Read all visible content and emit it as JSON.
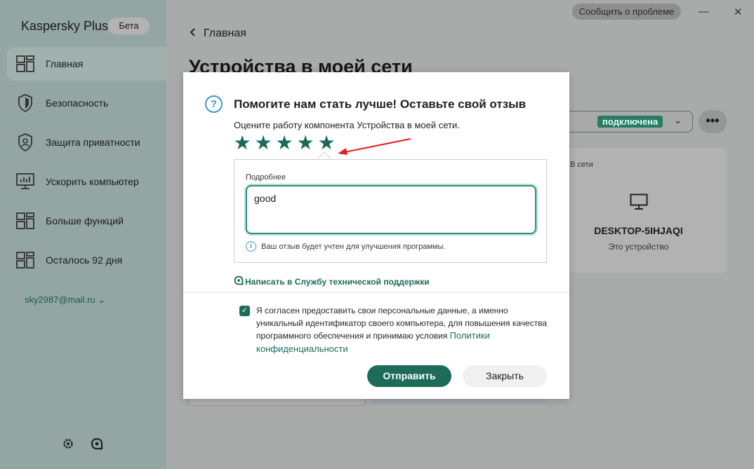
{
  "app": {
    "title": "Kaspersky Plus",
    "badge": "Бета",
    "report_button": "Сообщить о проблеме",
    "minimize": "—",
    "close": "✕"
  },
  "sidebar": {
    "items": [
      {
        "label": "Главная",
        "icon": "home-grid-icon"
      },
      {
        "label": "Безопасность",
        "icon": "shield-icon"
      },
      {
        "label": "Защита приватности",
        "icon": "privacy-shield-icon"
      },
      {
        "label": "Ускорить компьютер",
        "icon": "monitor-speed-icon"
      },
      {
        "label": "Больше функций",
        "icon": "grid-icon"
      },
      {
        "label": "Осталось 92 дня",
        "icon": "license-grid-icon"
      }
    ],
    "account": "sky2987@mail.ru ⌄",
    "bottom_icons": [
      "gear-icon",
      "support-icon"
    ]
  },
  "main": {
    "back_label": "Главная",
    "page_title": "Устройства в моей сети",
    "network_status": "подключена",
    "more": "•••",
    "device": {
      "status": "В сети",
      "name": "DESKTOP-5IHJAQI",
      "subtitle": "Это устройство"
    }
  },
  "dialog": {
    "title": "Помогите нам стать лучше! Оставьте свой отзыв",
    "subtitle": "Оцените работу компонента Устройства в моей сети.",
    "rating": 5,
    "max_rating": 5,
    "details_label": "Подробнее",
    "details_value": "good",
    "hint": "Ваш отзыв будет учтен для улучшения программы.",
    "support_link": "Написать в Службу технической поддержки",
    "consent_checked": true,
    "consent_text": "Я согласен предоставить свои персональные данные, а именно уникальный идентификатор своего компьютера, для повышения качества программного обеспечения и принимаю условия",
    "consent_link": "Политики конфиденциальности",
    "send_button": "Отправить",
    "close_button": "Закрыть"
  },
  "colors": {
    "accent": "#1d6b5b",
    "info": "#3b9bc9",
    "annotation_arrow": "#e02020"
  }
}
